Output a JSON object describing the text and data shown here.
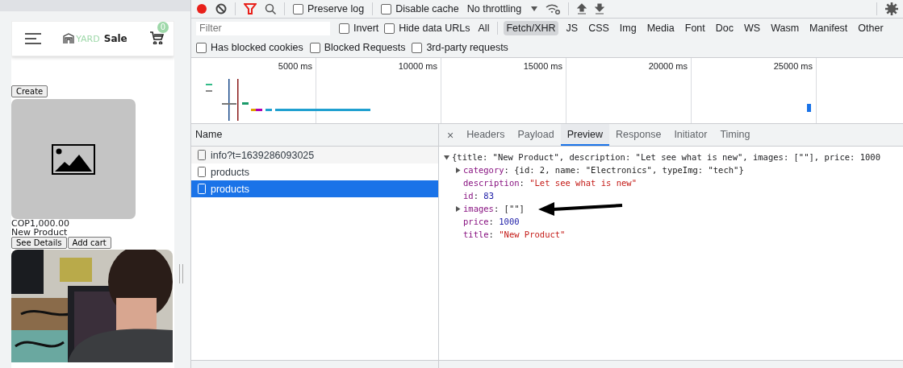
{
  "app": {
    "logo_yard": "YARD",
    "logo_sale": "Sale",
    "cart_count": "0",
    "create_button": "Create",
    "products": [
      {
        "kind": "placeholder",
        "price": "COP1,000.00",
        "title": "New Product",
        "buttons": [
          "See Details",
          "Add cart"
        ]
      },
      {
        "kind": "picture"
      }
    ]
  },
  "devtools": {
    "toolbar": {
      "recording": true,
      "preserve_log": {
        "label": "Preserve log",
        "checked": false
      },
      "disable_cache": {
        "label": "Disable cache",
        "checked": false
      },
      "throttling": "No throttling"
    },
    "filter": {
      "placeholder": "Filter",
      "invert": {
        "label": "Invert",
        "checked": false
      },
      "hide_data_urls": {
        "label": "Hide data URLs",
        "checked": false
      },
      "types": [
        {
          "label": "All",
          "selected": false
        },
        {
          "label": "Fetch/XHR",
          "selected": true
        },
        {
          "label": "JS",
          "selected": false
        },
        {
          "label": "CSS",
          "selected": false
        },
        {
          "label": "Img",
          "selected": false
        },
        {
          "label": "Media",
          "selected": false
        },
        {
          "label": "Font",
          "selected": false
        },
        {
          "label": "Doc",
          "selected": false
        },
        {
          "label": "WS",
          "selected": false
        },
        {
          "label": "Wasm",
          "selected": false
        },
        {
          "label": "Manifest",
          "selected": false
        },
        {
          "label": "Other",
          "selected": false
        }
      ],
      "extra": [
        {
          "label": "Has blocked cookies",
          "checked": false
        },
        {
          "label": "Blocked Requests",
          "checked": false
        },
        {
          "label": "3rd-party requests",
          "checked": false
        }
      ]
    },
    "overview": {
      "ticks": [
        "5000 ms",
        "10000 ms",
        "15000 ms",
        "20000 ms",
        "25000 ms"
      ]
    },
    "requests": {
      "column": "Name",
      "rows": [
        {
          "name": "info?t=1639286093025",
          "selected": false
        },
        {
          "name": "products",
          "selected": false
        },
        {
          "name": "products",
          "selected": true
        }
      ]
    },
    "close_button": "×",
    "detail_tabs": [
      {
        "label": "Headers",
        "selected": false
      },
      {
        "label": "Payload",
        "selected": false
      },
      {
        "label": "Preview",
        "selected": true
      },
      {
        "label": "Response",
        "selected": false
      },
      {
        "label": "Initiator",
        "selected": false
      },
      {
        "label": "Timing",
        "selected": false
      }
    ],
    "preview": {
      "separator": ":",
      "summary": "{title: \"New Product\", description: \"Let see what is new\", images: [\"\"], price: 1000",
      "expanded": true,
      "properties": [
        {
          "key": "category",
          "value": "{id: 2, name: \"Electronics\", typeImg: \"tech\"}",
          "kind": "object",
          "expanded": false
        },
        {
          "key": "description",
          "value": "\"Let see what is new\"",
          "kind": "string"
        },
        {
          "key": "id",
          "value": "83",
          "kind": "number"
        },
        {
          "key": "images",
          "value": "[\"\"]",
          "kind": "object",
          "expanded": false
        },
        {
          "key": "price",
          "value": "1000",
          "kind": "number"
        },
        {
          "key": "title",
          "value": "\"New Product\"",
          "kind": "string"
        }
      ]
    }
  }
}
